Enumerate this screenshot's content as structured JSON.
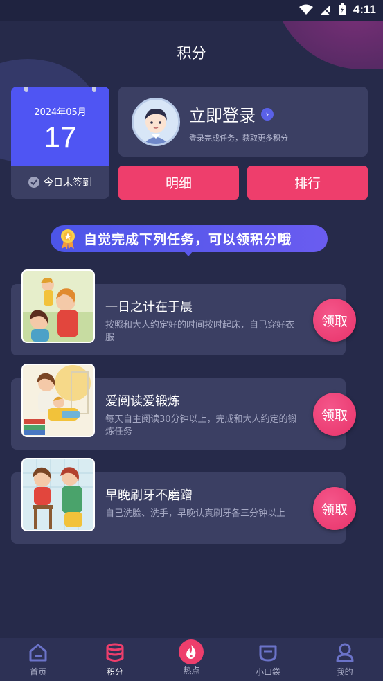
{
  "status_bar": {
    "time": "4:11"
  },
  "header": {
    "title": "积分"
  },
  "calendar": {
    "month": "2024年05月",
    "day": "17",
    "sign_status": "今日未签到"
  },
  "login": {
    "title": "立即登录",
    "subtitle": "登录完成任务，获取更多积分"
  },
  "actions": {
    "detail": "明细",
    "rank": "排行"
  },
  "banner": {
    "text": "自觉完成下列任务，可以领积分哦"
  },
  "tasks": [
    {
      "title": "一日之计在于晨",
      "desc": "按照和大人约定好的时间按时起床，自己穿好衣服",
      "button": "领取"
    },
    {
      "title": "爱阅读爱锻炼",
      "desc": "每天自主阅读30分钟以上，完成和大人约定的锻炼任务",
      "button": "领取"
    },
    {
      "title": "早晚刷牙不磨蹭",
      "desc": "自己洗脸、洗手，早晚认真刷牙各三分钟以上",
      "button": "领取"
    }
  ],
  "tabbar": {
    "items": [
      {
        "label": "首页",
        "icon": "home-icon"
      },
      {
        "label": "积分",
        "icon": "coins-icon"
      },
      {
        "label": "热点",
        "icon": "flame-icon"
      },
      {
        "label": "小口袋",
        "icon": "pocket-icon"
      },
      {
        "label": "我的",
        "icon": "user-icon"
      }
    ]
  },
  "colors": {
    "background": "#262a4a",
    "card": "#3b3f63",
    "accent_pink": "#ee3e6c",
    "accent_blue": "#4f55f3"
  }
}
